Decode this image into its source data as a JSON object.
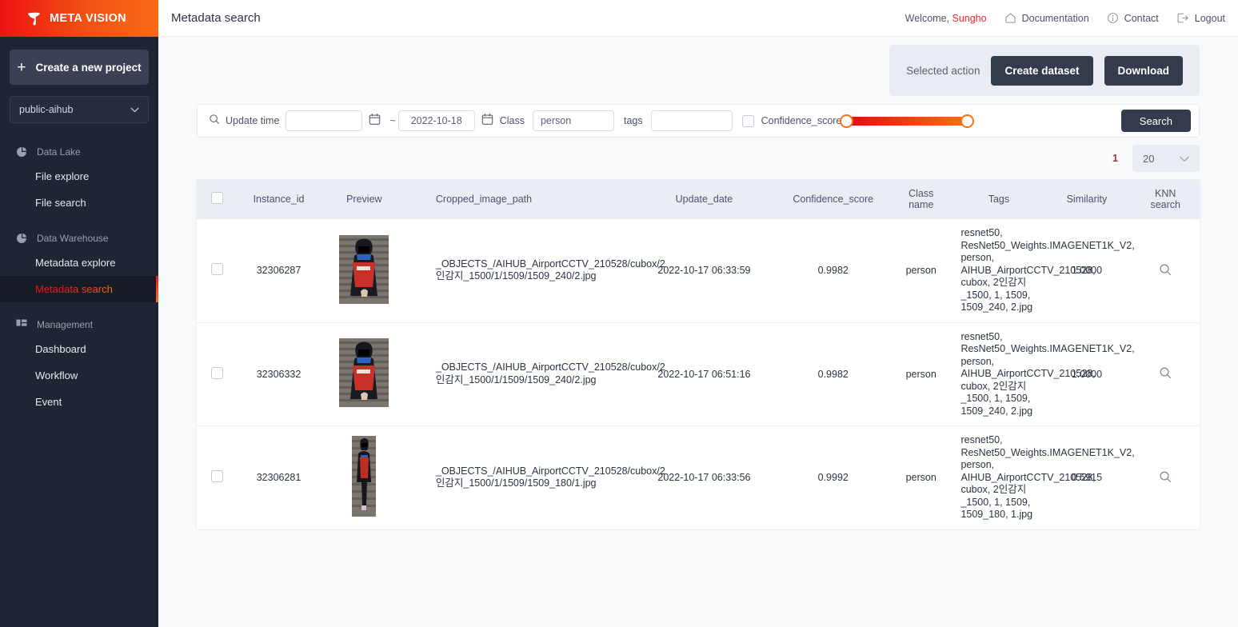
{
  "brand": {
    "name": "META VISION",
    "logo_icon": "flag-logo-icon",
    "gradient_from": "#ee1111",
    "gradient_to": "#f96a16"
  },
  "sidebar": {
    "create_project_label": "Create a new project",
    "project_selected": "public-aihub",
    "groups": [
      {
        "label": "Data Lake",
        "icon": "pie-chart-icon",
        "items": [
          {
            "label": "File explore",
            "active": false
          },
          {
            "label": "File search",
            "active": false
          }
        ]
      },
      {
        "label": "Data Warehouse",
        "icon": "pie-chart-icon",
        "items": [
          {
            "label": "Metadata explore",
            "active": false
          },
          {
            "label": "Metadata search",
            "active": true
          }
        ]
      },
      {
        "label": "Management",
        "icon": "dashboard-grid-icon",
        "items": [
          {
            "label": "Dashboard",
            "active": false
          },
          {
            "label": "Workflow",
            "active": false
          },
          {
            "label": "Event",
            "active": false
          }
        ]
      }
    ],
    "active_item": "Metadata search",
    "active_color_from": "#f4151b",
    "active_color_to": "#f97316"
  },
  "topbar": {
    "title": "Metadata search",
    "welcome_prefix": "Welcome, ",
    "user": "Sungho",
    "user_color": "#f4222d",
    "links": [
      {
        "label": "Documentation",
        "icon": "home-icon"
      },
      {
        "label": "Contact",
        "icon": "info-circle-icon"
      },
      {
        "label": "Logout",
        "icon": "logout-icon"
      }
    ]
  },
  "action_bar": {
    "label": "Selected action",
    "create_dataset_label": "Create dataset",
    "download_label": "Download"
  },
  "filters": {
    "update_time_label": "Update time",
    "search_icon": "search-icon",
    "date_from_value": "",
    "date_from_placeholder": "",
    "range_separator": "~",
    "date_to_value": "2022-10-18",
    "calendar_icon": "calendar-icon",
    "class_label": "Class",
    "class_value": "person",
    "tags_label": "tags",
    "tags_value": "",
    "confidence_label": "Confidence_score",
    "confidence_checked": false,
    "slider_from_color": "#e30613",
    "slider_to_color": "#f97316",
    "search_button_label": "Search"
  },
  "pagination": {
    "current_page": "1",
    "page_size": "20"
  },
  "table": {
    "columns": [
      "",
      "Instance_id",
      "Preview",
      "Cropped_image_path",
      "Update_date",
      "Confidence_score",
      "Class name",
      "Tags",
      "Similarity",
      "KNN search"
    ],
    "class_name_line1": "Class",
    "class_name_line2": "name",
    "knn_line1": "KNN",
    "knn_line2": "search",
    "knn_icon": "magnifier-icon",
    "rows": [
      {
        "checked": false,
        "instance_id": "32306287",
        "preview_alt": "cropped-person-thumbnail",
        "cropped_image_path": "_OBJECTS_/AIHUB_AirportCCTV_210528/cubox/2인감지_1500/1/1509/1509_240/2.jpg",
        "update_date": "2022-10-17 06:33:59",
        "confidence_score": "0.9982",
        "class_name": "person",
        "tags": "resnet50, ResNet50_Weights.IMAGENET1K_V2, person, AIHUB_AirportCCTV_210528, cubox, 2인감지_1500, 1, 1509, 1509_240, 2.jpg",
        "similarity": "1.0000"
      },
      {
        "checked": false,
        "instance_id": "32306332",
        "preview_alt": "cropped-person-thumbnail",
        "cropped_image_path": "_OBJECTS_/AIHUB_AirportCCTV_210528/cubox/2인감지_1500/1/1509/1509_240/2.jpg",
        "update_date": "2022-10-17 06:51:16",
        "confidence_score": "0.9982",
        "class_name": "person",
        "tags": "resnet50, ResNet50_Weights.IMAGENET1K_V2, person, AIHUB_AirportCCTV_210528, cubox, 2인감지_1500, 1, 1509, 1509_240, 2.jpg",
        "similarity": "1.0000"
      },
      {
        "checked": false,
        "instance_id": "32306281",
        "preview_alt": "cropped-person-thumbnail",
        "cropped_image_path": "_OBJECTS_/AIHUB_AirportCCTV_210528/cubox/2인감지_1500/1/1509/1509_180/1.jpg",
        "update_date": "2022-10-17 06:33:56",
        "confidence_score": "0.9992",
        "class_name": "person",
        "tags": "resnet50, ResNet50_Weights.IMAGENET1K_V2, person, AIHUB_AirportCCTV_210528, cubox, 2인감지_1500, 1, 1509, 1509_180, 1.jpg",
        "similarity": "0.5915"
      }
    ]
  }
}
